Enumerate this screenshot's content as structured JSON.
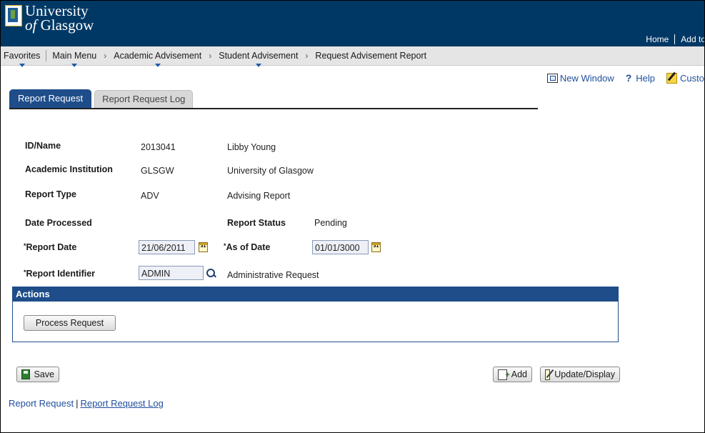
{
  "header": {
    "logo_line1": "University",
    "logo_line2_prefix": "of",
    "logo_line2": "Glasgow",
    "links": [
      "Home",
      "Add to"
    ]
  },
  "nav": {
    "items": [
      "Favorites",
      "Main Menu",
      "Academic Advisement",
      "Student Advisement",
      "Request Advisement Report"
    ],
    "separator": "›"
  },
  "toolbar": {
    "new_window": "New Window",
    "help": "Help",
    "customize": "Custo"
  },
  "tabs": {
    "active": "Report Request",
    "inactive": "Report Request Log"
  },
  "form": {
    "id_name_label": "ID/Name",
    "id_value": "2013041",
    "name_value": "Libby Young",
    "institution_label": "Academic Institution",
    "institution_code": "GLSGW",
    "institution_name": "University of Glasgow",
    "report_type_label": "Report Type",
    "report_type_code": "ADV",
    "report_type_name": "Advising Report",
    "date_processed_label": "Date Processed",
    "report_status_label": "Report Status",
    "report_status_value": "Pending",
    "report_date_label": "Report Date",
    "report_date_value": "21/06/2011",
    "as_of_date_label": "As of Date",
    "as_of_date_value": "01/01/3000",
    "report_identifier_label": "Report Identifier",
    "report_identifier_value": "ADMIN",
    "report_identifier_desc": "Administrative Request",
    "required_mark": "*",
    "calendar_glyph": "31"
  },
  "actions": {
    "title": "Actions",
    "process_button": "Process Request"
  },
  "buttons": {
    "save": "Save",
    "add": "Add",
    "update_display": "Update/Display"
  },
  "footer": {
    "current": "Report Request",
    "separator": "|",
    "link": "Report Request Log"
  },
  "colors": {
    "header_bg": "#003865",
    "tab_active": "#1e4d8a",
    "link": "#1f4e9c"
  }
}
